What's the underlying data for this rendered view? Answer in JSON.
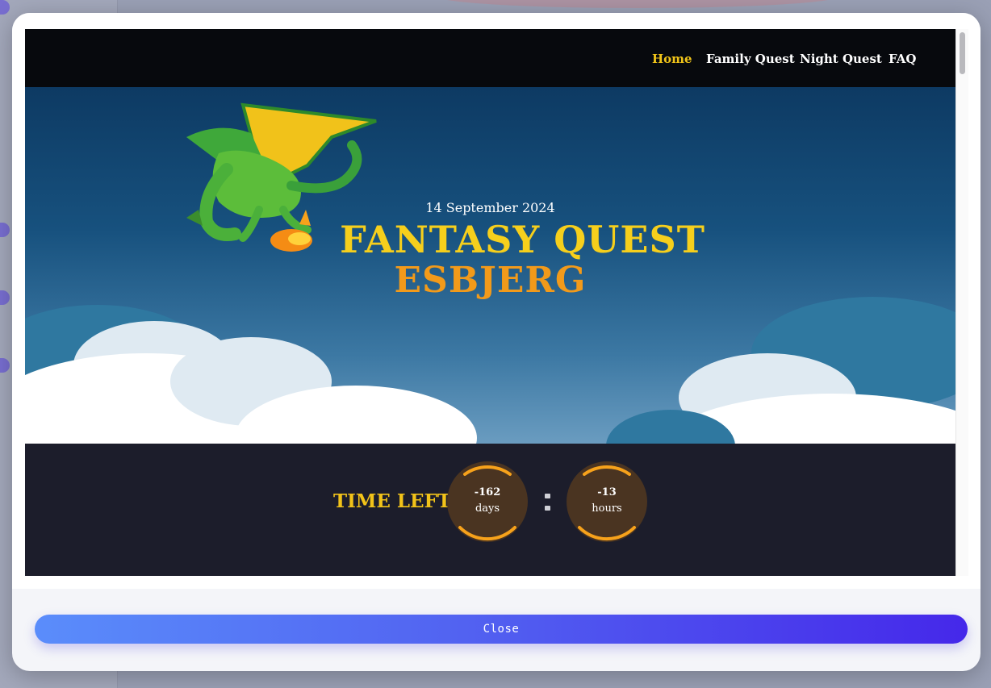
{
  "site": {
    "nav": [
      {
        "label": "Home",
        "active": true
      },
      {
        "label": "Family Quest",
        "active": false
      },
      {
        "label": "Night Quest",
        "active": false
      },
      {
        "label": "FAQ",
        "active": false
      }
    ],
    "hero": {
      "date": "14 September 2024",
      "title_line1": "FANTASY QUEST",
      "title_line2": "ESBJERG"
    },
    "countdown": {
      "label": "TIME LEFT",
      "days_value": "-162",
      "days_unit": "days",
      "hours_value": "-13",
      "hours_unit": "hours"
    }
  },
  "modal": {
    "close_label": "Close"
  },
  "colors": {
    "nav_active": "#f0c419",
    "title_yellow": "#f6cf1c",
    "title_orange": "#f29a1a",
    "ring_accent": "#f7a21b",
    "close_gradient_start": "#5a8dfb",
    "close_gradient_end": "#4528ea"
  },
  "icons": {
    "dragon": "dragon-logo-icon",
    "scroll": "scrollbar-thumb"
  }
}
